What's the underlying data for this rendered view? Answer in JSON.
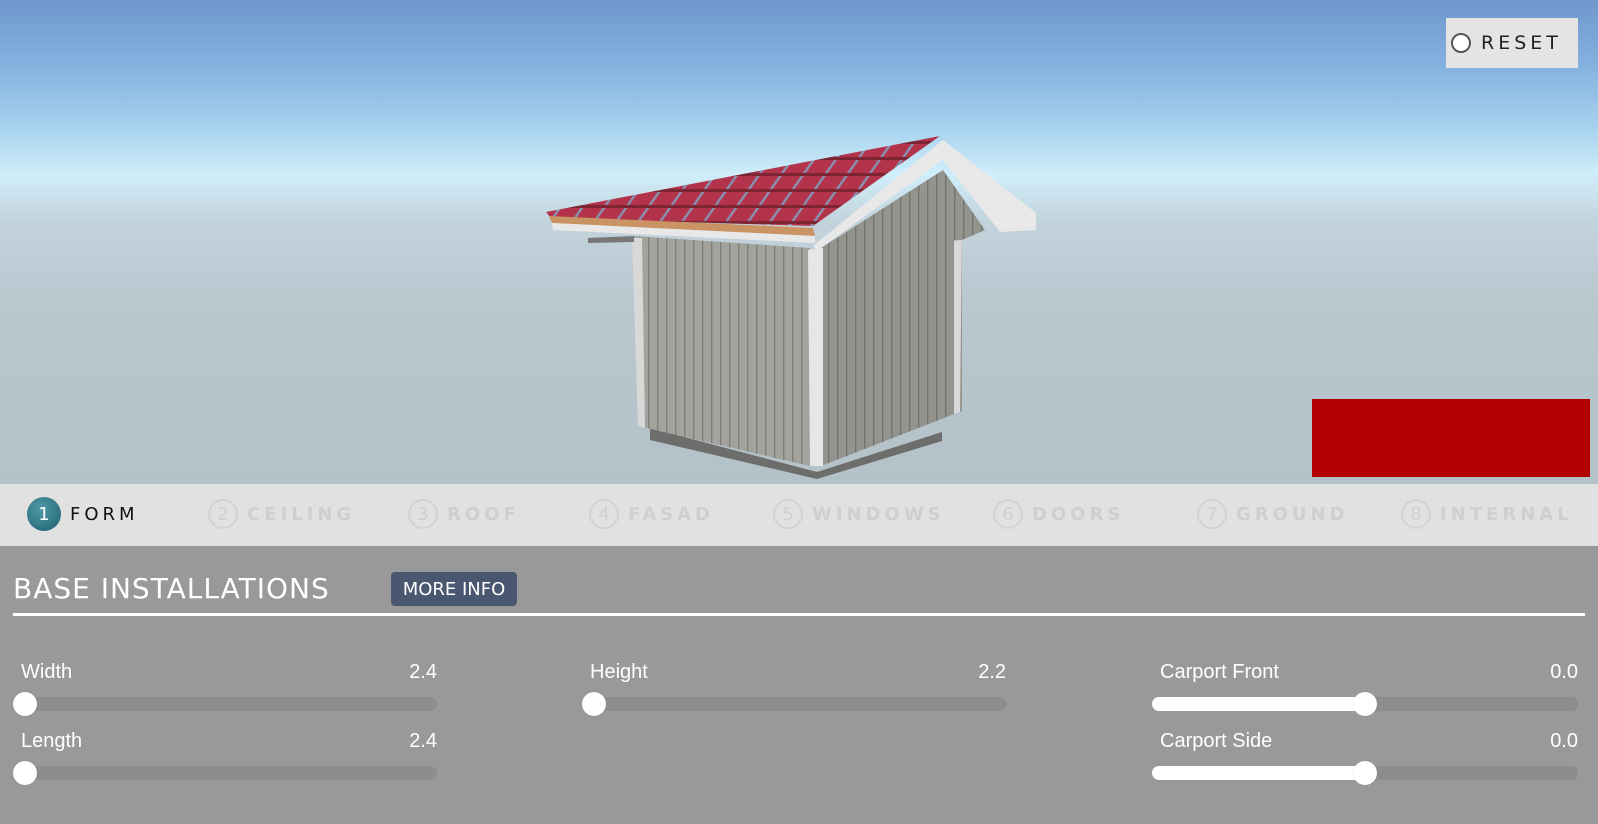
{
  "viewport": {
    "reset_label": "RESET",
    "overlay_color": "#b30000",
    "roof_color": "#b23a4a",
    "wall_color": "#9a9a96"
  },
  "tabs": [
    {
      "number": "1",
      "label": "FORM",
      "active": true
    },
    {
      "number": "2",
      "label": "CEILING",
      "active": false
    },
    {
      "number": "3",
      "label": "ROOF",
      "active": false
    },
    {
      "number": "4",
      "label": "FASAD",
      "active": false
    },
    {
      "number": "5",
      "label": "WINDOWS",
      "active": false
    },
    {
      "number": "6",
      "label": "DOORS",
      "active": false
    },
    {
      "number": "7",
      "label": "GROUND",
      "active": false
    },
    {
      "number": "8",
      "label": "INTERNAL",
      "active": false
    }
  ],
  "panel": {
    "title": "BASE INSTALLATIONS",
    "more_info_label": "MORE INFO",
    "sliders": {
      "width": {
        "label": "Width",
        "value": "2.4",
        "fraction": 0.0
      },
      "length": {
        "label": "Length",
        "value": "2.4",
        "fraction": 0.0
      },
      "height": {
        "label": "Height",
        "value": "2.2",
        "fraction": 0.0
      },
      "carport_front": {
        "label": "Carport Front",
        "value": "0.0",
        "fraction": 0.5
      },
      "carport_side": {
        "label": "Carport Side",
        "value": "0.0",
        "fraction": 0.5
      }
    }
  },
  "colors": {
    "tab_active": "#2b7280",
    "more_info_bg": "#4a5770",
    "panel_bg": "#999999",
    "tabs_bg": "#e1e1e1"
  }
}
